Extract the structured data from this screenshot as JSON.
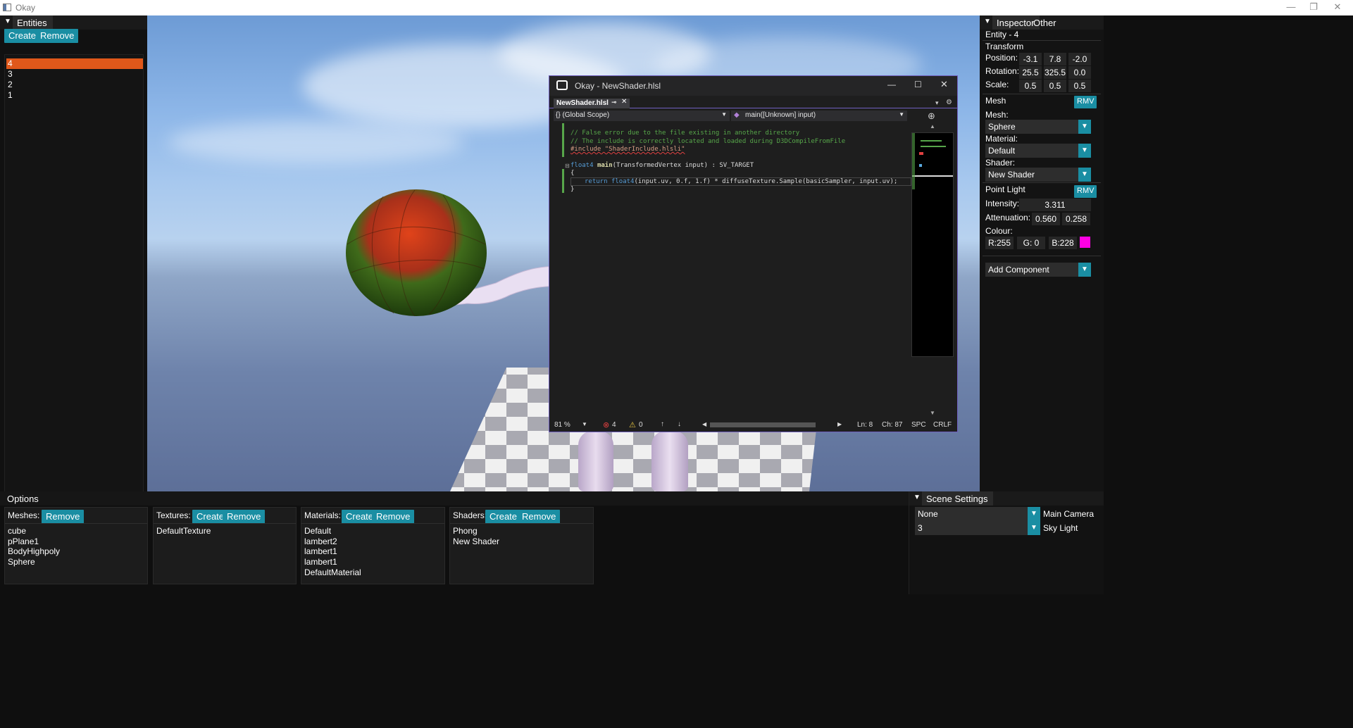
{
  "window": {
    "title": "Okay",
    "buttons": [
      "—",
      "❐",
      "✕"
    ]
  },
  "entities": {
    "tab": "Entities",
    "create_label": "Create",
    "remove_label": "Remove",
    "items": [
      "4",
      "3",
      "2",
      "1"
    ],
    "selected": "4"
  },
  "inspector": {
    "tabs": [
      "Inspector",
      "Other"
    ],
    "entity_title": "Entity - 4",
    "transform": {
      "title": "Transform",
      "position_label": "Position:",
      "position": [
        "-3.1",
        "7.8",
        "-2.0"
      ],
      "rotation_label": "Rotation:",
      "rotation": [
        "25.5",
        "325.5",
        "0.0"
      ],
      "scale_label": "Scale:",
      "scale": [
        "0.5",
        "0.5",
        "0.5"
      ]
    },
    "mesh": {
      "title": "Mesh",
      "rmv_label": "RMV",
      "mesh_label": "Mesh:",
      "mesh_value": "Sphere",
      "material_label": "Material:",
      "material_value": "Default",
      "shader_label": "Shader:",
      "shader_value": "New Shader"
    },
    "point_light": {
      "title": "Point Light",
      "rmv_label": "RMV",
      "intensity_label": "Intensity:",
      "intensity": "3.311",
      "attenuation_label": "Attenuation:",
      "attenuation": [
        "0.560",
        "0.258"
      ],
      "colour_label": "Colour:",
      "r": "R:255",
      "g": "G:  0",
      "b": "B:228",
      "swatch": "#ff00e4"
    },
    "add_component": "Add Component"
  },
  "options": {
    "title": "Options",
    "meshes": {
      "label": "Meshes:",
      "remove": "Remove",
      "items": [
        "cube",
        "pPlane1",
        "BodyHighpoly",
        "Sphere"
      ]
    },
    "textures": {
      "label": "Textures:",
      "create": "Create",
      "remove": "Remove",
      "items": [
        "DefaultTexture"
      ]
    },
    "materials": {
      "label": "Materials:",
      "create": "Create",
      "remove": "Remove",
      "items": [
        "Default",
        "lambert2",
        "lambert1",
        "lambert1",
        "DefaultMaterial"
      ]
    },
    "shaders": {
      "label": "Shaders:",
      "create": "Create",
      "remove": "Remove",
      "items": [
        "Phong",
        "New Shader"
      ]
    }
  },
  "scene_settings": {
    "title": "Scene Settings",
    "camera_value": "None",
    "camera_label": "Main Camera",
    "sky_value": "3",
    "sky_label": "Sky Light"
  },
  "editor": {
    "title": "Okay - NewShader.hlsl",
    "tab": "NewShader.hlsl",
    "scope_left": "{} (Global Scope)",
    "scope_right": "main([Unknown] input)",
    "code": {
      "line1": "// False error due to the file existing in another directory",
      "line2": "// The include is correctly located and loaded during D3DCompileFromFile",
      "line3": "#include \"ShaderInclude.hlsli\"",
      "line5_type": "float4",
      "line5_name": "main",
      "line5_rest": "(TransformedVertex input) : SV_TARGET",
      "line6": "{",
      "line7_kw": "return",
      "line7_type": "float4",
      "line7_rest": "(input.uv, 0.f, 1.f) * diffuseTexture.Sample(basicSampler, input.uv);",
      "line8": "}"
    },
    "status": {
      "zoom": "81 %",
      "errors": "4",
      "warnings": "0",
      "ln": "Ln: 8",
      "ch": "Ch: 87",
      "spc": "SPC",
      "crlf": "CRLF"
    }
  }
}
